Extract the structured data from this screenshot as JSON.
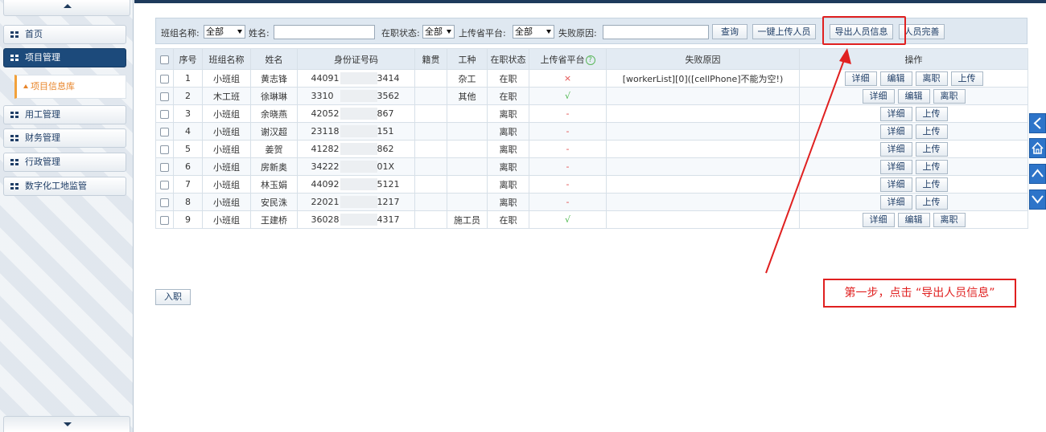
{
  "sidebar": {
    "items": [
      {
        "label": "首页"
      },
      {
        "label": "项目管理"
      },
      {
        "label": "项目信息库"
      },
      {
        "label": "用工管理"
      },
      {
        "label": "财务管理"
      },
      {
        "label": "行政管理"
      },
      {
        "label": "数字化工地监管"
      }
    ]
  },
  "filter": {
    "team_label": "班组名称:",
    "team_value": "全部",
    "name_label": "姓名:",
    "status_label": "在职状态:",
    "status_value": "全部",
    "platform_label": "上传省平台:",
    "platform_value": "全部",
    "reason_label": "失败原因:",
    "query_button": "查询",
    "upload_all_button": "一键上传人员",
    "export_button": "导出人员信息",
    "complete_button": "人员完善"
  },
  "table": {
    "headers": [
      "序号",
      "班组名称",
      "姓名",
      "身份证号码",
      "籍贯",
      "工种",
      "在职状态",
      "上传省平台",
      "失败原因",
      "操作"
    ],
    "rows": [
      {
        "no": "1",
        "team": "小班组",
        "name": "黄志锋",
        "id_start": "44091",
        "id_end": "3414",
        "origin": "",
        "trade": "杂工",
        "status": "在职",
        "platform": "×",
        "platform_kind": "fail",
        "reason": "[workerList][0]([cellPhone]不能为空!)",
        "ops": [
          "详细",
          "编辑",
          "离职",
          "上传"
        ]
      },
      {
        "no": "2",
        "team": "木工班",
        "name": "徐琳琳",
        "id_start": "3310",
        "id_end": "3562",
        "origin": "",
        "trade": "其他",
        "status": "在职",
        "platform": "√",
        "platform_kind": "ok",
        "reason": "",
        "ops": [
          "详细",
          "编辑",
          "离职"
        ]
      },
      {
        "no": "3",
        "team": "小班组",
        "name": "余晓燕",
        "id_start": "42052",
        "id_end": "867",
        "origin": "",
        "trade": "",
        "status": "离职",
        "platform": "-",
        "platform_kind": "none",
        "reason": "",
        "ops": [
          "详细",
          "上传"
        ]
      },
      {
        "no": "4",
        "team": "小班组",
        "name": "谢汉超",
        "id_start": "23118",
        "id_end": "151",
        "origin": "",
        "trade": "",
        "status": "离职",
        "platform": "-",
        "platform_kind": "none",
        "reason": "",
        "ops": [
          "详细",
          "上传"
        ]
      },
      {
        "no": "5",
        "team": "小班组",
        "name": "姜贺",
        "id_start": "41282",
        "id_end": "862",
        "origin": "",
        "trade": "",
        "status": "离职",
        "platform": "-",
        "platform_kind": "none",
        "reason": "",
        "ops": [
          "详细",
          "上传"
        ]
      },
      {
        "no": "6",
        "team": "小班组",
        "name": "房新奥",
        "id_start": "34222",
        "id_end": "01X",
        "origin": "",
        "trade": "",
        "status": "离职",
        "platform": "-",
        "platform_kind": "none",
        "reason": "",
        "ops": [
          "详细",
          "上传"
        ]
      },
      {
        "no": "7",
        "team": "小班组",
        "name": "林玉娟",
        "id_start": "44092",
        "id_end": "5121",
        "origin": "",
        "trade": "",
        "status": "离职",
        "platform": "-",
        "platform_kind": "none",
        "reason": "",
        "ops": [
          "详细",
          "上传"
        ]
      },
      {
        "no": "8",
        "team": "小班组",
        "name": "安民洙",
        "id_start": "22021",
        "id_end": "1217",
        "origin": "",
        "trade": "",
        "status": "离职",
        "platform": "-",
        "platform_kind": "none",
        "reason": "",
        "ops": [
          "详细",
          "上传"
        ]
      },
      {
        "no": "9",
        "team": "小班组",
        "name": "王建桥",
        "id_start": "36028",
        "id_end": "4317",
        "origin": "",
        "trade": "施工员",
        "status": "在职",
        "platform": "√",
        "platform_kind": "ok",
        "reason": "",
        "ops": [
          "详细",
          "编辑",
          "离职"
        ]
      }
    ]
  },
  "hire_button": "入职",
  "annotation": "第一步，点击 “导出人员信息”",
  "colors": {
    "nav_dark": "#1c4a7b",
    "accent_orange": "#e8852a",
    "annotation_red": "#e02020",
    "ok_green": "#49b749",
    "float_blue": "#2d74c9"
  },
  "icons": {
    "float_nav": [
      "chevron-left-icon",
      "home-icon",
      "chevron-up-icon",
      "chevron-down-icon"
    ]
  }
}
